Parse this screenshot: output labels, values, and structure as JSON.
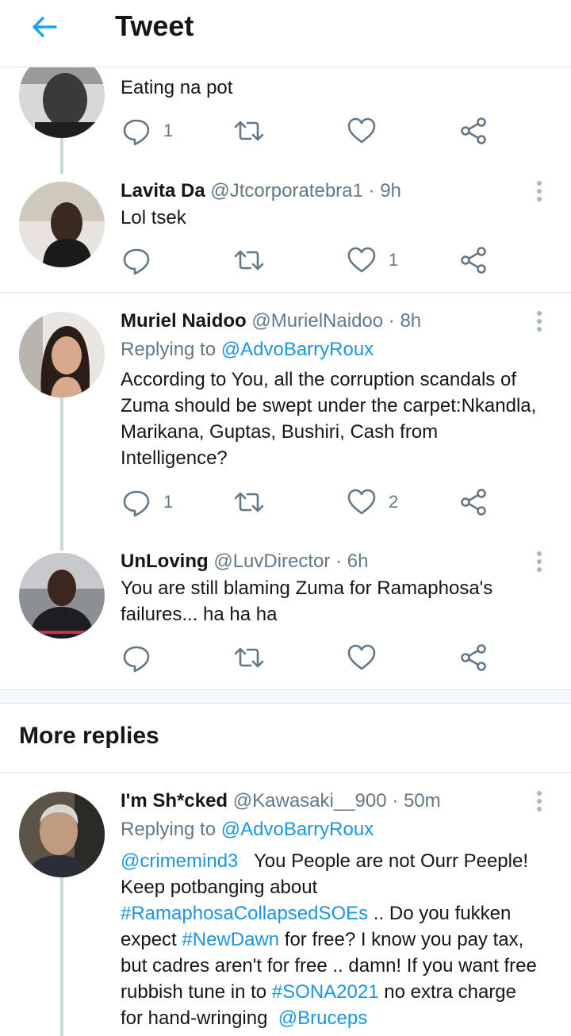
{
  "header": {
    "title": "Tweet"
  },
  "tweets": [
    {
      "name": "",
      "handle": "",
      "time": "",
      "text": "Eating na pot",
      "reply_count": "1",
      "retweet_count": "",
      "like_count": ""
    },
    {
      "name": "Lavita Da",
      "handle": "@Jtcorporatebra1",
      "time": "9h",
      "text": "Lol tsek",
      "reply_count": "",
      "retweet_count": "",
      "like_count": "1"
    },
    {
      "name": "Muriel Naidoo",
      "handle": "@MurielNaidoo",
      "time": "8h",
      "replying_prefix": "Replying to",
      "replying_to": "@AdvoBarryRoux",
      "text_lines": [
        "According to You, all the corruption scandals of",
        "Zuma should be swept under the carpet:Nkandla,",
        "Marikana, Guptas, Bushiri, Cash from",
        "Intelligence?"
      ],
      "reply_count": "1",
      "retweet_count": "",
      "like_count": "2"
    },
    {
      "name": "UnLoving",
      "handle": "@LuvDirector",
      "time": "6h",
      "text_lines": [
        "You are still blaming Zuma for Ramaphosa's",
        "failures... ha ha ha"
      ],
      "reply_count": "",
      "retweet_count": "",
      "like_count": ""
    }
  ],
  "more_replies": {
    "title": "More replies",
    "tweet": {
      "name": "I'm Sh*cked",
      "handle": "@Kawasaki__900",
      "time": "50m",
      "replying_prefix": "Replying to",
      "replying_to": "@AdvoBarryRoux",
      "mention1": "@crimemind3",
      "text1": "You People are not Ourr Peeple!",
      "text2": "Keep potbanging about",
      "hashtag1": "#RamaphosaCollapsedSOEs",
      "text3": ".. Do you fukken",
      "text4": "expect",
      "hashtag2": "#NewDawn",
      "text5": "for free? I know you pay tax,",
      "text6": "but cadres aren't for free .. damn! If you want free",
      "text7": "rubbish tune in to",
      "hashtag3": "#SONA2021",
      "text8": "no extra charge",
      "text9": "for hand-wringing",
      "mention2": "@Bruceps"
    }
  },
  "dot": "·",
  "colors": {
    "accent": "#1b95e0",
    "secondary_text": "#657786",
    "divider": "#e1e8ed"
  },
  "icons": [
    "back-arrow-icon",
    "reply-icon",
    "retweet-icon",
    "like-icon",
    "share-icon",
    "more-vertical-icon"
  ]
}
